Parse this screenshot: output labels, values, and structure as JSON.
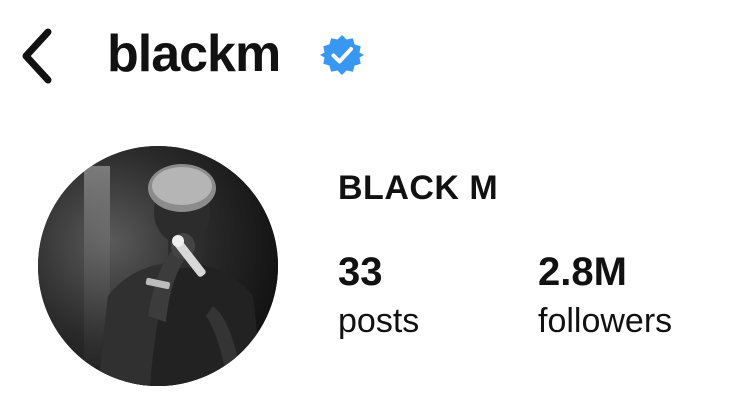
{
  "header": {
    "username": "blackm",
    "verified_color": "#3897f0",
    "back_icon": "chevron-left-icon",
    "verified_icon": "verified-badge-icon"
  },
  "profile": {
    "display_name": "BLACK M",
    "avatar_icon": "profile-photo",
    "stats": {
      "posts": {
        "value": "33",
        "label": "posts"
      },
      "followers": {
        "value": "2.8M",
        "label": "followers"
      }
    }
  }
}
